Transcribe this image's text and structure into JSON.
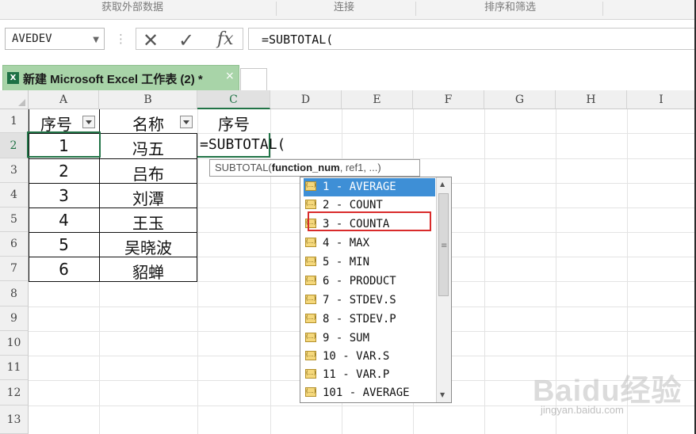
{
  "ribbon": {
    "groups": [
      "获取外部数据",
      "连接",
      "排序和筛选"
    ]
  },
  "formula_bar": {
    "name_box": "AVEDEV",
    "formula": "=SUBTOTAL("
  },
  "tab": {
    "title": "新建 Microsoft Excel 工作表 (2) *",
    "close_glyph": "×"
  },
  "columns": [
    "A",
    "B",
    "C",
    "D",
    "E",
    "F",
    "G",
    "H",
    "I"
  ],
  "rows": [
    "1",
    "2",
    "3",
    "4",
    "5",
    "6",
    "7",
    "8",
    "9",
    "10",
    "11",
    "12",
    "13"
  ],
  "table": {
    "headers": {
      "a": "序号",
      "b": "名称",
      "c": "序号"
    },
    "data": [
      {
        "a": "1",
        "b": "冯五"
      },
      {
        "a": "2",
        "b": "吕布"
      },
      {
        "a": "3",
        "b": "刘潭"
      },
      {
        "a": "4",
        "b": "王玉"
      },
      {
        "a": "5",
        "b": "吴晓波"
      },
      {
        "a": "6",
        "b": "貂蝉"
      }
    ]
  },
  "active_cell_text": "=SUBTOTAL(",
  "tooltip": {
    "func": "SUBTOTAL(",
    "arg_bold": "function_num",
    "rest": ", ref1, ...)"
  },
  "dropdown": {
    "selected_index": 0,
    "highlighted_index": 2,
    "items": [
      "1 - AVERAGE",
      "2 - COUNT",
      "3 - COUNTA",
      "4 - MAX",
      "5 - MIN",
      "6 - PRODUCT",
      "7 - STDEV.S",
      "8 - STDEV.P",
      "9 - SUM",
      "10 - VAR.S",
      "11 - VAR.P",
      "101 - AVERAGE"
    ]
  },
  "watermark": {
    "logo": "Baidu经验",
    "url": "jingyan.baidu.com"
  },
  "colors": {
    "excel_green": "#217346",
    "tab_green": "#a8d4a8",
    "selection_blue": "#3e8fd6",
    "annotation_red": "#d92b2b"
  }
}
